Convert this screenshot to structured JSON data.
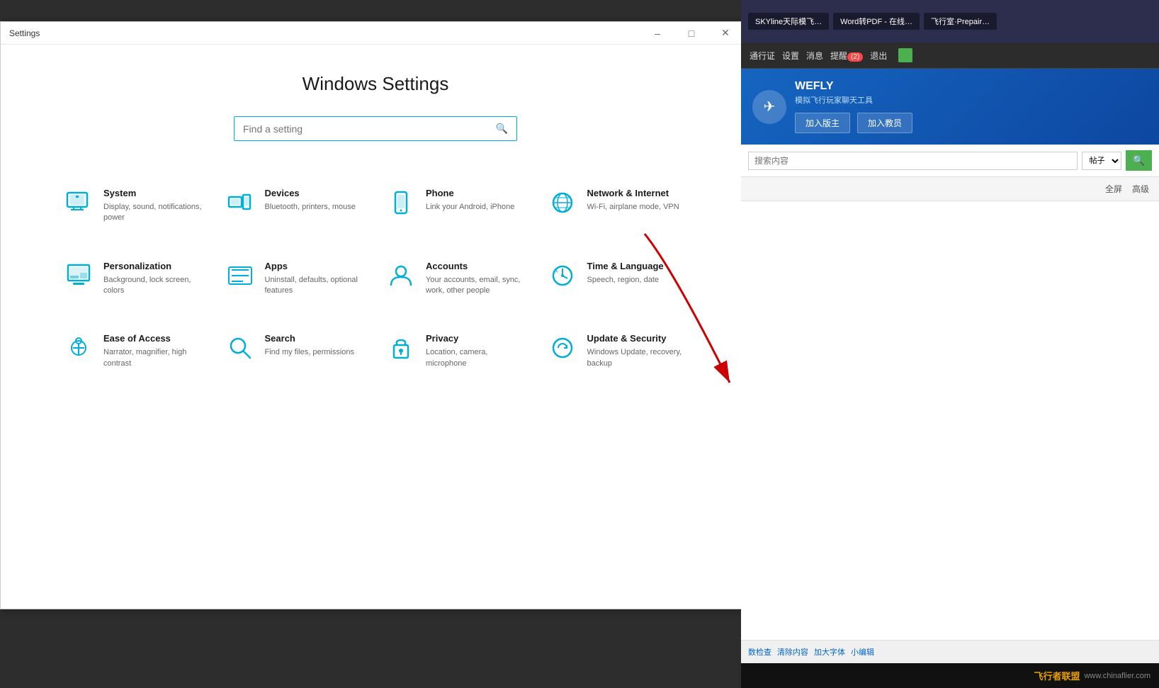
{
  "browser": {
    "url": "https://bbs.chinaflier.com/forum.php?mod=post&action=reply&fid=16242407&extra=&tid=138278&repquote=1012750&cedit=yes",
    "tabs": [
      {
        "label": "SKYline天际模飞…",
        "id": "tab-skyline"
      },
      {
        "label": "Word转PDF - 在线…",
        "id": "tab-word"
      },
      {
        "label": "飞行室·Prepair…",
        "id": "tab-fly"
      }
    ]
  },
  "window": {
    "title": "Settings",
    "controls": {
      "minimize": "–",
      "maximize": "□",
      "close": "✕"
    }
  },
  "settings": {
    "main_title": "Windows Settings",
    "search_placeholder": "Find a setting",
    "items": [
      {
        "id": "system",
        "name": "System",
        "desc": "Display, sound, notifications, power"
      },
      {
        "id": "devices",
        "name": "Devices",
        "desc": "Bluetooth, printers, mouse"
      },
      {
        "id": "phone",
        "name": "Phone",
        "desc": "Link your Android, iPhone"
      },
      {
        "id": "network",
        "name": "Network & Internet",
        "desc": "Wi-Fi, airplane mode, VPN"
      },
      {
        "id": "personalization",
        "name": "Personalization",
        "desc": "Background, lock screen, colors"
      },
      {
        "id": "apps",
        "name": "Apps",
        "desc": "Uninstall, defaults, optional features"
      },
      {
        "id": "accounts",
        "name": "Accounts",
        "desc": "Your accounts, email, sync, work, other people"
      },
      {
        "id": "time",
        "name": "Time & Language",
        "desc": "Speech, region, date"
      },
      {
        "id": "ease",
        "name": "Ease of Access",
        "desc": "Narrator, magnifier, high contrast"
      },
      {
        "id": "search",
        "name": "Search",
        "desc": "Find my files, permissions"
      },
      {
        "id": "privacy",
        "name": "Privacy",
        "desc": "Location, camera, microphone"
      },
      {
        "id": "update",
        "name": "Update & Security",
        "desc": "Windows Update, recovery, backup"
      }
    ]
  },
  "forum": {
    "nav_items": [
      "通行证",
      "设置",
      "消息",
      "提醒(2)",
      "退出"
    ],
    "wefly": {
      "title": "WEFLY",
      "subtitle": "模拟飞行玩家聊天工具",
      "btn1": "加入版主",
      "btn2": "加入教员"
    },
    "search": {
      "placeholder": "搜索内容",
      "select_options": [
        "帖子"
      ],
      "btn_label": "🔍"
    },
    "toolbar_btns": [
      "全屏",
      "高级"
    ],
    "bottom_links": [
      "数检查",
      "清除内容",
      "加大字体",
      "小编辑"
    ],
    "watermark": "飞行者联盟",
    "site": "www.chinaflier.com"
  }
}
